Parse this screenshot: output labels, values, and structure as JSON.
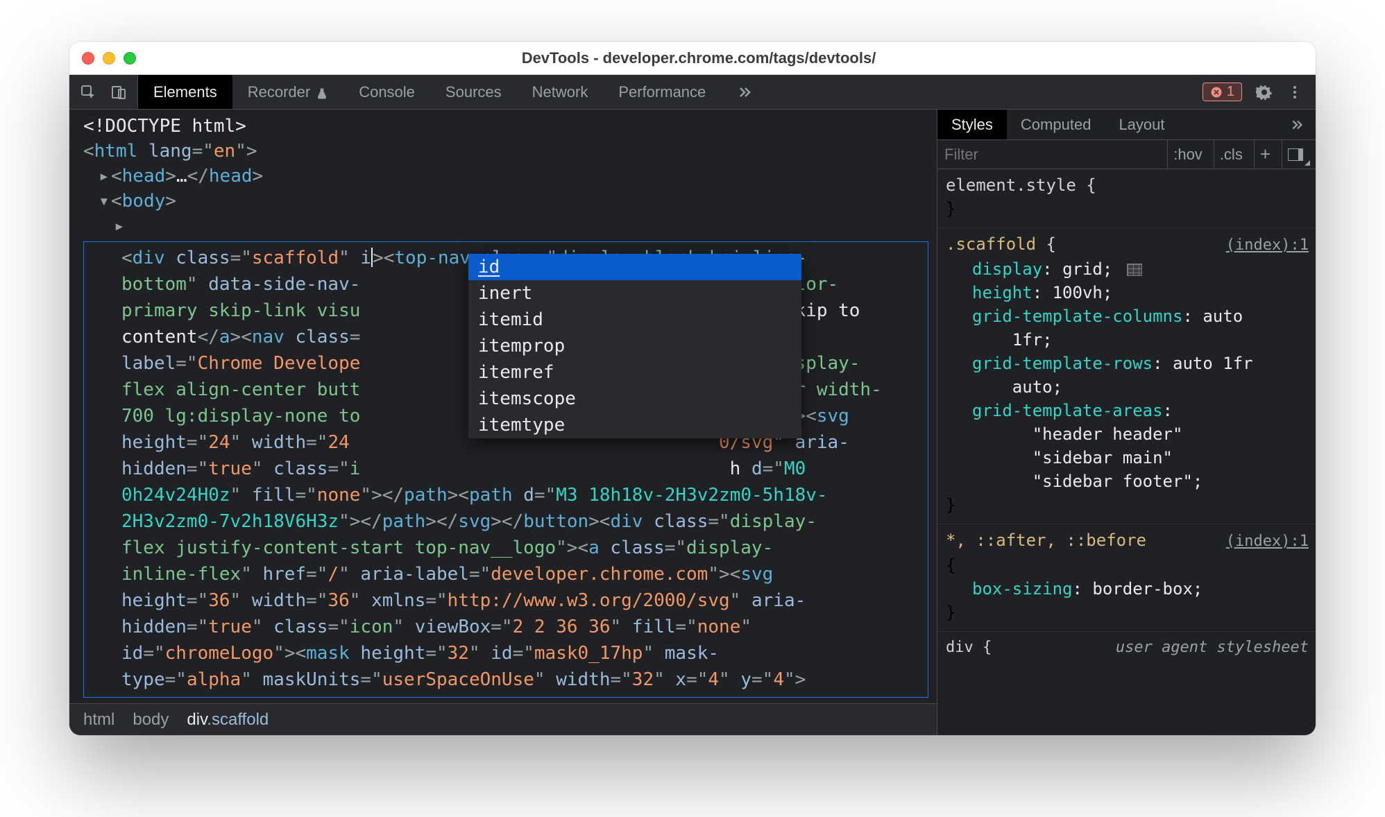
{
  "window": {
    "title": "DevTools - developer.chrome.com/tags/devtools/"
  },
  "toolbar": {
    "tabs": [
      "Elements",
      "Recorder",
      "Console",
      "Sources",
      "Network",
      "Performance"
    ],
    "active_tab": "Elements",
    "error_count": "1"
  },
  "dom": {
    "doctype": "<!DOCTYPE html>",
    "html_open_tag": "html",
    "html_lang_attr": "lang",
    "html_lang_val": "en",
    "head_tag": "head",
    "head_ellipsis": "…",
    "body_tag": "body",
    "editing_attr_typed": "i",
    "edit_text_full": "<div class=\"scaffold\" i|><top-nav class=\"display-block hairline-bottom\" data-side-nav-                     ss=\"color-primary skip-link visu                      ent\">Skip to content</a><nav class=                      ria-label=\"Chrome Develope                      ss=\"display-flex align-center butt                      -center width-700 lg:display-none to                      \"menu\"><svg height=\"24\" width=\"24                      0/svg\" aria-hidden=\"true\" class=\"i                      h d=\"M0 0h24v24H0z\" fill=\"none\"></path><path d=\"M3 18h18v-2H3v2zm0-5h18v-2H3v2zm0-7v2h18V6H3z\"></path></svg></button><div class=\"display-flex justify-content-start top-nav__logo\"><a class=\"display-inline-flex\" href=\"/\" aria-label=\"developer.chrome.com\"><svg height=\"36\" width=\"36\" xmlns=\"http://www.w3.org/2000/svg\" aria-hidden=\"true\" class=\"icon\" viewBox=\"2 2 36 36\" fill=\"none\" id=\"chromeLogo\"><mask height=\"32\" id=\"mask0_17hp\" mask-type=\"alpha\" maskUnits=\"userSpaceOnUse\" width=\"32\" x=\"4\" y=\"4\">",
    "autocomplete": [
      "id",
      "inert",
      "itemid",
      "itemprop",
      "itemref",
      "itemscope",
      "itemtype"
    ],
    "autocomplete_selected": "id"
  },
  "breadcrumbs": {
    "items": [
      "html",
      "body"
    ],
    "active_tag": "div",
    "active_class": ".scaffold"
  },
  "styles": {
    "tabs": [
      "Styles",
      "Computed",
      "Layout"
    ],
    "active_tab": "Styles",
    "filter_placeholder": "Filter",
    "hov": ":hov",
    "cls": ".cls",
    "element_style_label": "element.style {",
    "rules": [
      {
        "selector": ".scaffold",
        "source": "(index):1",
        "decls": [
          {
            "prop": "display",
            "val": "grid",
            "grid_icon": true
          },
          {
            "prop": "height",
            "val": "100vh"
          },
          {
            "prop": "grid-template-columns",
            "val": "auto 1fr"
          },
          {
            "prop": "grid-template-rows",
            "val": "auto 1fr auto"
          },
          {
            "prop": "grid-template-areas",
            "val": "\"header header\" \"sidebar main\" \"sidebar footer\""
          }
        ]
      },
      {
        "selector": "*, ::after, ::before",
        "source": "(index):1",
        "decls": [
          {
            "prop": "box-sizing",
            "val": "border-box"
          }
        ]
      }
    ],
    "ua_selector": "div {",
    "ua_label": "user agent stylesheet"
  }
}
